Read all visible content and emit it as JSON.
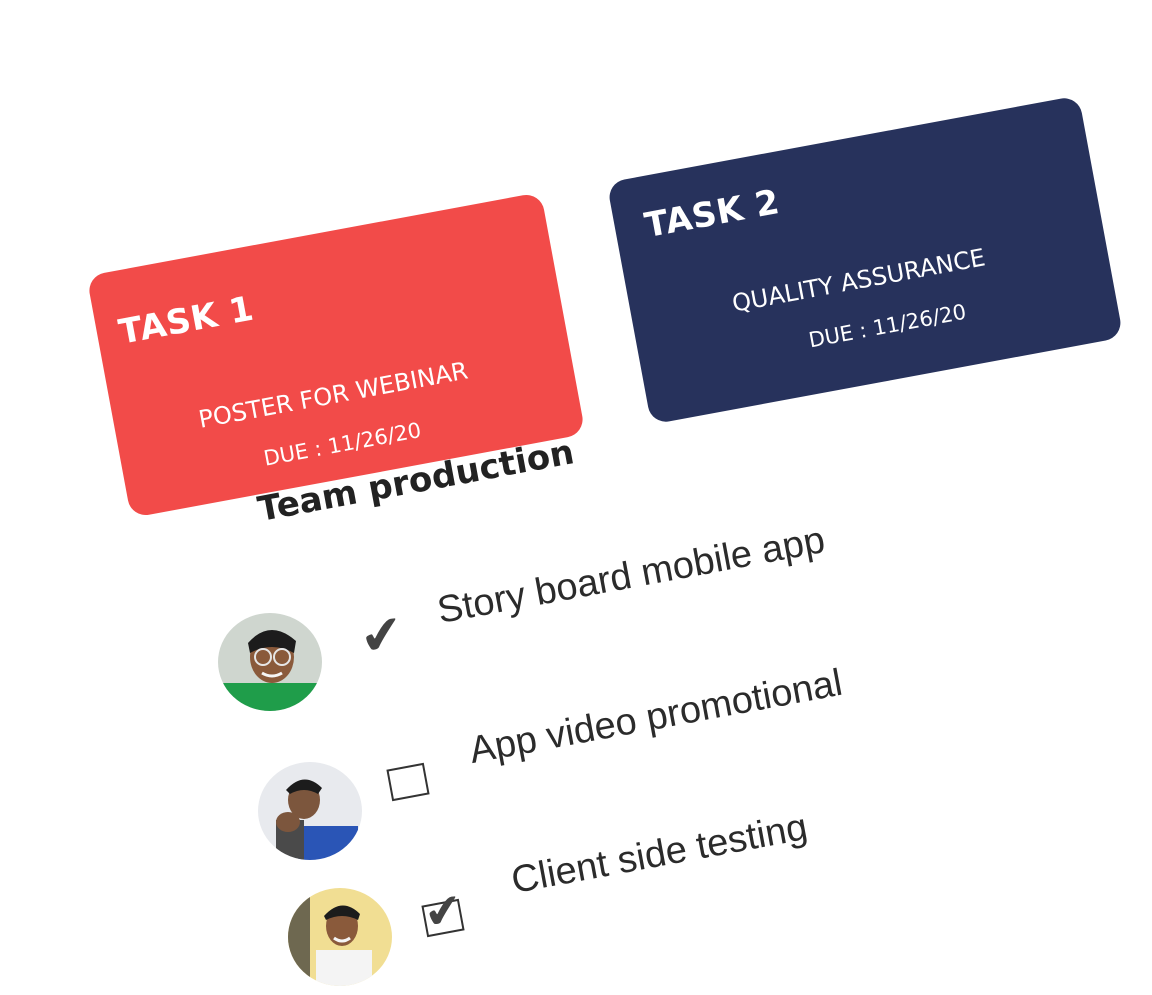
{
  "cards": [
    {
      "title": "TASK 1",
      "subtitle": "POSTER FOR WEBINAR",
      "due": "DUE : 11/26/20",
      "color": "#f24b49"
    },
    {
      "title": "TASK 2",
      "subtitle": "QUALITY ASSURANCE",
      "due": "DUE : 11/26/20",
      "color": "#27325c"
    }
  ],
  "team": {
    "heading": "Team production",
    "tasks": [
      {
        "label": "Story board mobile app",
        "status": "done",
        "icon": "checkmark-icon"
      },
      {
        "label": "App video promotional",
        "status": "unchecked",
        "icon": "empty-checkbox-icon"
      },
      {
        "label": "Client side testing",
        "status": "checked",
        "icon": "checked-checkbox-icon"
      }
    ]
  }
}
